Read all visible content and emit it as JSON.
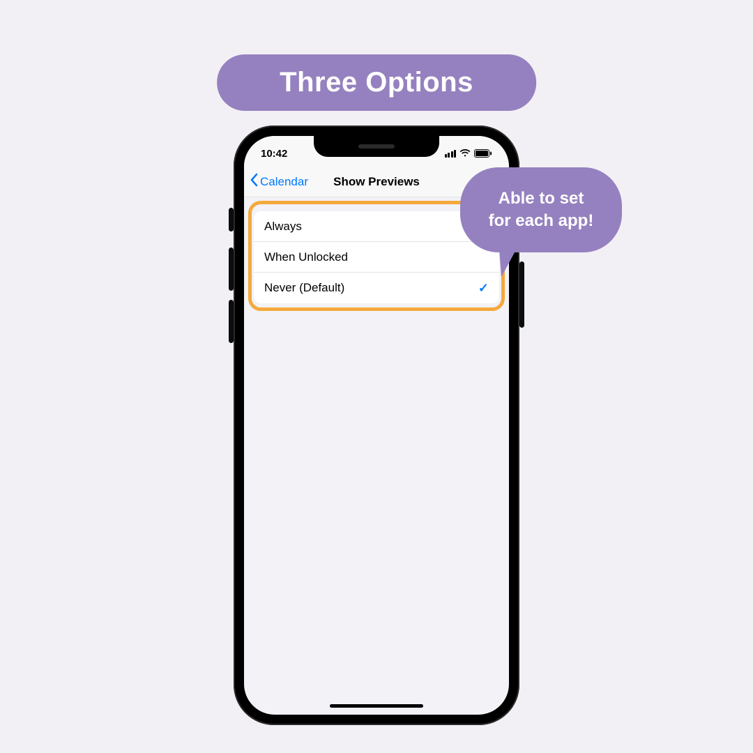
{
  "title": "Three Options",
  "callout": {
    "line1": "Able to set",
    "line2": "for each app!"
  },
  "status": {
    "time": "10:42"
  },
  "nav": {
    "back_label": "Calendar",
    "title": "Show Previews"
  },
  "options": [
    {
      "label": "Always",
      "selected": false
    },
    {
      "label": "When Unlocked",
      "selected": false
    },
    {
      "label": "Never (Default)",
      "selected": true
    }
  ],
  "colors": {
    "accent": "#9581bf",
    "highlight": "#f5a93c",
    "ios_blue": "#007aff",
    "bg": "#f3f0f5"
  }
}
